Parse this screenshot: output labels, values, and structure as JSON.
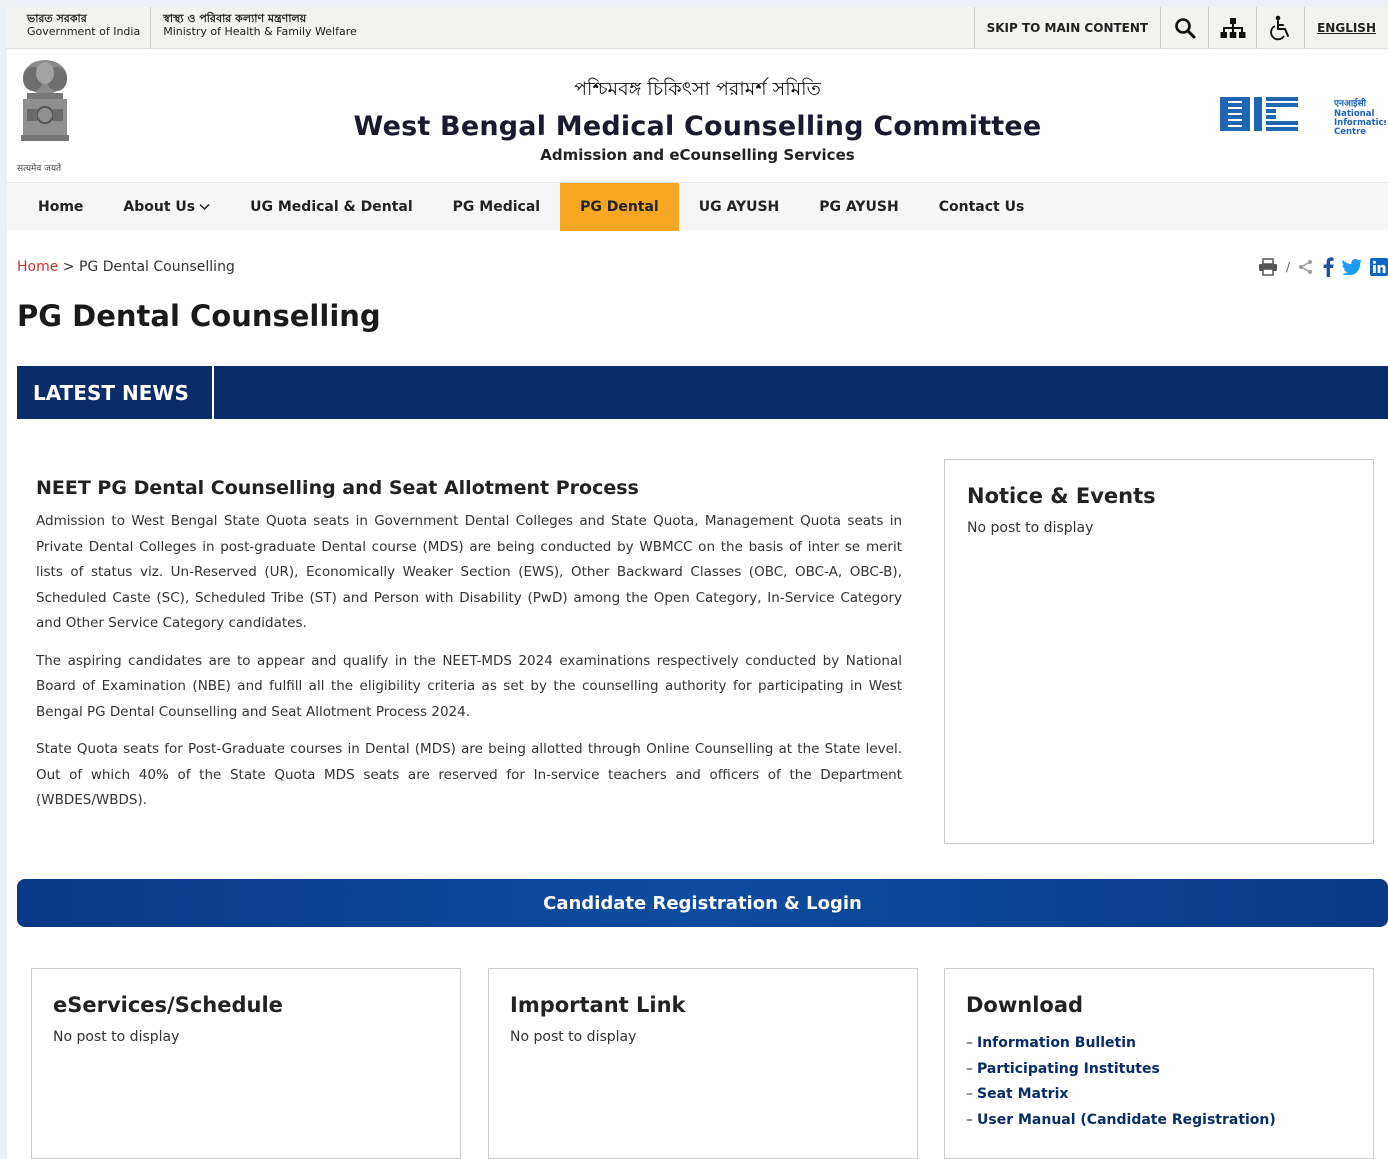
{
  "govbar": {
    "gov_bn": "ভারত সরকার",
    "gov_en": "Government of India",
    "ministry_bn": "স্বাস্থ্য ও পরিবার কল্যাণ মন্ত্রণালয়",
    "ministry_en": "Ministry of Health & Family Welfare",
    "skip_label": "SKIP TO MAIN CONTENT",
    "language_label": "ENGLISH"
  },
  "header": {
    "emblem_caption": "सत्यमेव जयते",
    "title_bn": "পশ্চিমবঙ্গ চিকিৎসা পরামর্শ সমিতি",
    "title": "West Bengal Medical Counselling Committee",
    "subtitle": "Admission and eCounselling Services",
    "nic_hi": "एनआईसी",
    "nic_line1": "National",
    "nic_line2": "Informatics",
    "nic_line3": "Centre"
  },
  "nav": {
    "items": [
      {
        "label": "Home"
      },
      {
        "label": "About Us"
      },
      {
        "label": "UG Medical & Dental"
      },
      {
        "label": "PG Medical"
      },
      {
        "label": "PG Dental"
      },
      {
        "label": "UG AYUSH"
      },
      {
        "label": "PG AYUSH"
      },
      {
        "label": "Contact Us"
      }
    ],
    "active": "PG Dental"
  },
  "breadcrumb": {
    "home": "Home",
    "separator": ">",
    "current": "PG Dental Counselling"
  },
  "share": {
    "print_separator": "/"
  },
  "page_title": "PG Dental Counselling",
  "news": {
    "label": "LATEST NEWS"
  },
  "article": {
    "heading": "NEET PG Dental Counselling and Seat Allotment Process",
    "paragraphs": [
      "Admission to West Bengal State Quota seats in Government Dental Colleges and State Quota, Management Quota seats in Private Dental Colleges in post-graduate Dental course (MDS) are being conducted by WBMCC on the basis of inter se merit lists of status viz. Un-Reserved (UR), Economically Weaker Section (EWS), Other Backward Classes (OBC, OBC-A, OBC-B), Scheduled Caste (SC), Scheduled Tribe (ST) and Person with Disability (PwD) among the Open Category, In-Service Category and Other Service Category candidates.",
      "The aspiring candidates are to appear and qualify in the NEET-MDS 2024 examinations respectively conducted by National Board of Examination (NBE) and fulfill all the eligibility criteria as set by the counselling authority for participating in West Bengal PG Dental Counselling and Seat Allotment Process 2024.",
      "State Quota seats for Post-Graduate courses in Dental (MDS) are being allotted through Online Counselling at the State level. Out of which 40% of the State Quota MDS seats are reserved for In-service teachers and officers of the Department (WBDES/WBDS)."
    ]
  },
  "notice": {
    "title": "Notice & Events",
    "empty": "No post to display"
  },
  "registration": {
    "label": "Candidate Registration & Login"
  },
  "cards": {
    "eservices": {
      "title": "eServices/Schedule",
      "empty": "No post to display"
    },
    "important": {
      "title": "Important Link",
      "empty": "No post to display"
    },
    "download": {
      "title": "Download",
      "dash": "–",
      "items": [
        "Information Bulletin",
        "Participating Institutes",
        "Seat Matrix",
        "User Manual (Candidate Registration)"
      ]
    }
  },
  "colors": {
    "accent": "#f5a623",
    "navy": "#0a2c68",
    "breadcrumb_home": "#c0392b"
  }
}
